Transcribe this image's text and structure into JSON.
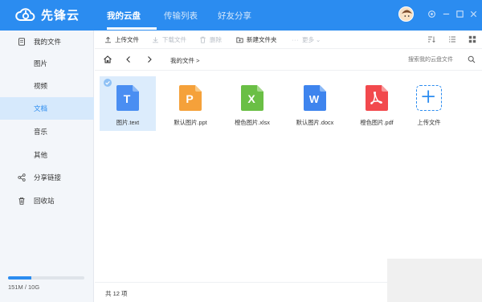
{
  "app": {
    "name": "先锋云",
    "brand_color": "#2b8cf0"
  },
  "nav": {
    "tabs": [
      {
        "label": "我的云盘",
        "active": true
      },
      {
        "label": "传输列表",
        "active": false
      },
      {
        "label": "好友分享",
        "active": false
      }
    ]
  },
  "window_controls": [
    "settings-icon",
    "minimize-icon",
    "maximize-icon",
    "close-icon"
  ],
  "sidebar": {
    "items": [
      {
        "label": "我的文件",
        "icon": "file-icon",
        "active": false
      },
      {
        "label": "图片",
        "active": false
      },
      {
        "label": "视频",
        "active": false
      },
      {
        "label": "文档",
        "active": true
      },
      {
        "label": "音乐",
        "active": false
      },
      {
        "label": "其他",
        "active": false
      },
      {
        "label": "分享链接",
        "icon": "share-icon",
        "active": false
      },
      {
        "label": "回收站",
        "icon": "trash-icon",
        "active": false
      }
    ],
    "storage": {
      "text": "151M / 10G",
      "used_fraction": 0.3
    }
  },
  "toolbar": {
    "upload": "上传文件",
    "download": "下载文件",
    "delete": "删除",
    "new_folder": "新建文件夹",
    "more": "更多"
  },
  "pathbar": {
    "breadcrumb": "我的文件 >",
    "search_placeholder": "搜索我的云盘文件"
  },
  "files": [
    {
      "name": "图片.text",
      "letter": "T",
      "color": "#4a8ef2",
      "selected": true
    },
    {
      "name": "默认图片.ppt",
      "letter": "P",
      "color": "#f5a13a",
      "selected": false
    },
    {
      "name": "橙色图片.xlsx",
      "letter": "X",
      "color": "#6abf45",
      "selected": false
    },
    {
      "name": "默认图片.docx",
      "letter": "W",
      "color": "#3e84ee",
      "selected": false
    },
    {
      "name": "橙色图片.pdf",
      "letter": "pdf",
      "color": "#f2494d",
      "selected": false
    },
    {
      "name": "上传文件",
      "letter": "+",
      "color": "#2b8cf0",
      "selected": false
    }
  ],
  "status": {
    "count": "共 12 项"
  }
}
